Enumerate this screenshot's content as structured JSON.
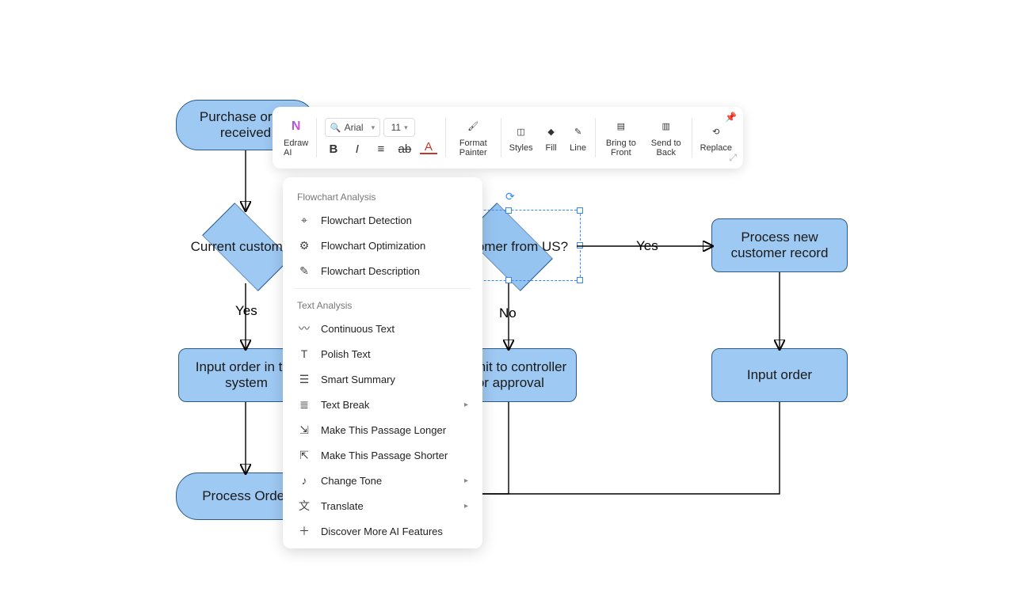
{
  "flowchart": {
    "nodes": {
      "purchase_order": "Purchase order received",
      "current_customer": "Current customer?",
      "customer_us": "Customer from US?",
      "process_new_record": "Process new customer record",
      "input_order_system": "Input order in the system",
      "submit_controller": "Submit to controller for approval",
      "input_order": "Input order",
      "process_order": "Process Order"
    },
    "edge_labels": {
      "current_yes": "Yes",
      "us_yes": "Yes",
      "us_no": "No"
    }
  },
  "toolbar": {
    "edraw_ai": "Edraw AI",
    "font_name": "Arial",
    "font_size": "11",
    "format_painter": "Format Painter",
    "styles": "Styles",
    "fill": "Fill",
    "line": "Line",
    "bring_front": "Bring to Front",
    "send_back": "Send to Back",
    "replace": "Replace"
  },
  "ai_panel": {
    "section1": "Flowchart Analysis",
    "items1": [
      "Flowchart Detection",
      "Flowchart Optimization",
      "Flowchart Description"
    ],
    "section2": "Text Analysis",
    "items2": [
      "Continuous Text",
      "Polish Text",
      "Smart Summary",
      "Text Break",
      "Make This Passage Longer",
      "Make This Passage Shorter",
      "Change Tone",
      "Translate",
      "Discover More AI Features"
    ],
    "submenu_flags": {
      "Text Break": true,
      "Change Tone": true,
      "Translate": true
    }
  }
}
